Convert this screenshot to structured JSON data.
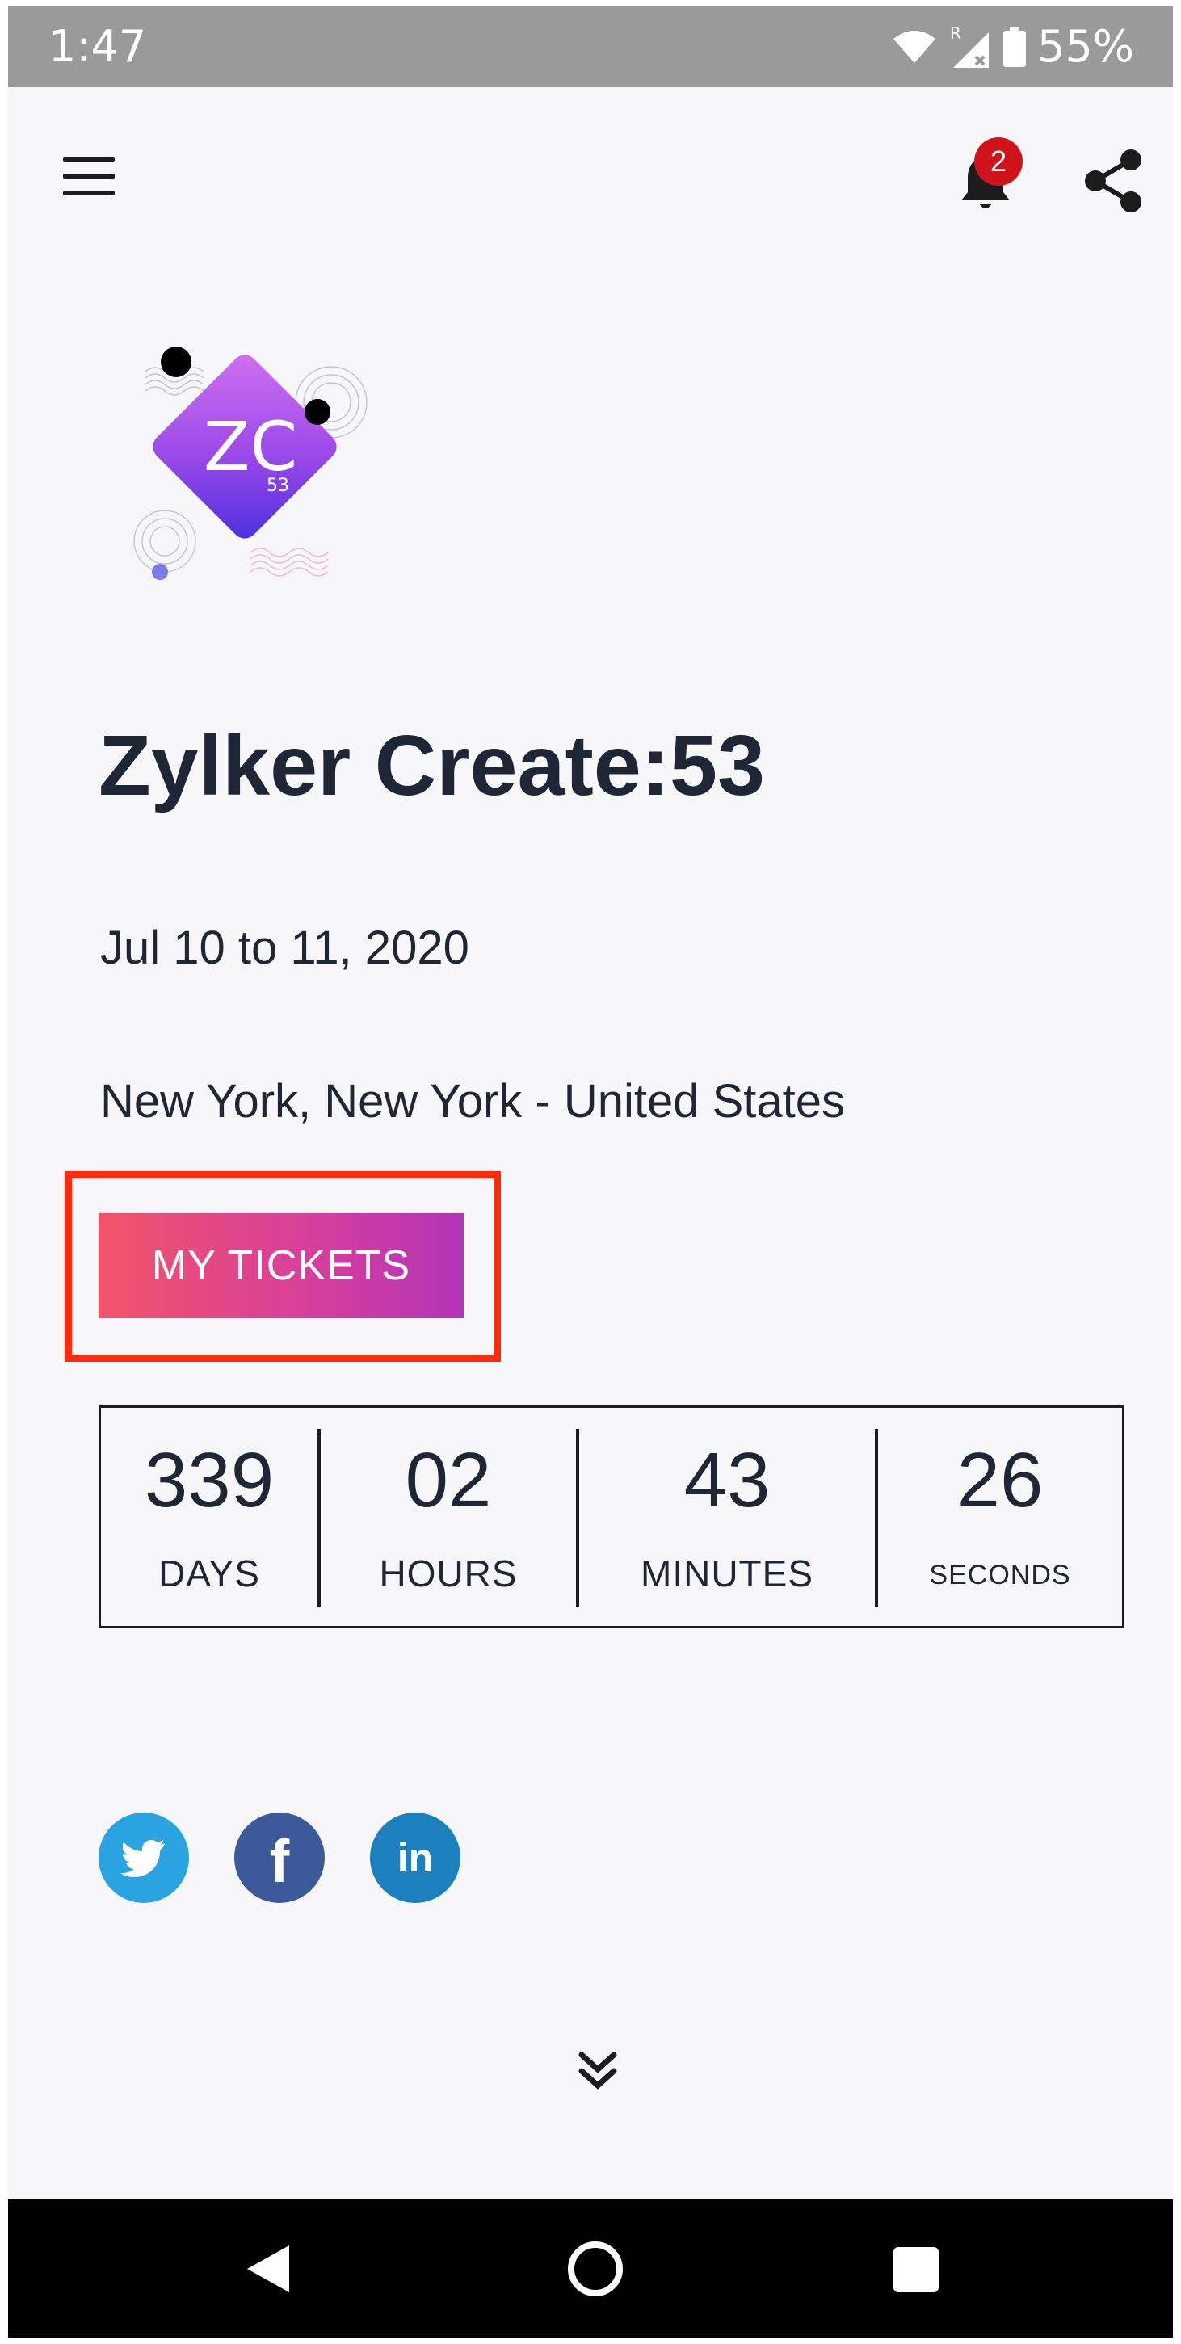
{
  "status_bar": {
    "time": "1:47",
    "battery_percent": "55%",
    "icons": [
      "wifi-icon",
      "signal-icon",
      "battery-icon"
    ]
  },
  "header": {
    "menu_icon": "hamburger-menu-icon",
    "notification_icon": "bell-icon",
    "notification_count": "2",
    "share_icon": "share-icon"
  },
  "logo": {
    "text_main": "ZC",
    "text_sub": "53"
  },
  "event": {
    "title": "Zylker Create:53",
    "date": "Jul 10 to 11, 2020",
    "location": "New York, New York - United States",
    "tickets_button_label": "MY TICKETS"
  },
  "countdown": {
    "days": "339",
    "days_label": "DAYS",
    "hours": "02",
    "hours_label": "HOURS",
    "minutes": "43",
    "minutes_label": "MINUTES",
    "seconds": "26",
    "seconds_label": "SECONDS"
  },
  "social": {
    "twitter_icon": "twitter-icon",
    "facebook_icon": "facebook-icon",
    "linkedin_icon": "linkedin-icon",
    "facebook_glyph": "f",
    "linkedin_glyph": "in"
  },
  "colors": {
    "highlight": "#ff2a0a",
    "button_start": "#f25368",
    "button_end": "#b334b8",
    "twitter": "#2aa3e1",
    "facebook": "#3c5a99",
    "linkedin": "#1b80bd",
    "badge": "#d0121b"
  },
  "nav_bar": {
    "icons": [
      "back-icon",
      "home-icon",
      "recents-icon"
    ]
  }
}
